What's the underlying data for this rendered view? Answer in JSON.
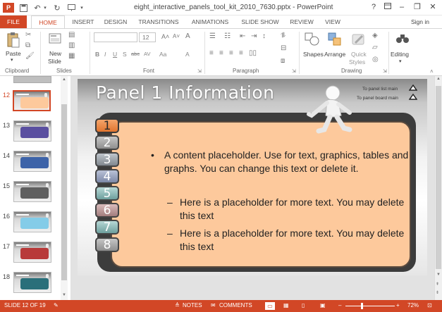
{
  "app": {
    "doc_title": "eight_interactive_panels_tool_kit_2010_7630.pptx - PowerPoint"
  },
  "tabs": [
    {
      "label": "FILE"
    },
    {
      "label": "HOME"
    },
    {
      "label": "INSERT"
    },
    {
      "label": "DESIGN"
    },
    {
      "label": "TRANSITIONS"
    },
    {
      "label": "ANIMATIONS"
    },
    {
      "label": "SLIDE SHOW"
    },
    {
      "label": "REVIEW"
    },
    {
      "label": "VIEW"
    }
  ],
  "signin": "Sign in",
  "ribbon": {
    "paste_label": "Paste",
    "new_slide_label": "New",
    "new_slide_label2": "Slide",
    "font_size": "12",
    "shapes_label": "Shapes",
    "arrange_label": "Arrange",
    "quick_styles_label": "Quick",
    "quick_styles_label2": "Styles",
    "editing_label": "Editing",
    "groups": {
      "clipboard": "Clipboard",
      "slides": "Slides",
      "font": "Font",
      "paragraph": "Paragraph",
      "drawing": "Drawing"
    },
    "format_buttons": [
      "B",
      "I",
      "U",
      "S",
      "abc",
      "AV",
      "Aa",
      "A"
    ]
  },
  "thumbnails": [
    {
      "num": "12",
      "color": "#fdc99c",
      "border": "#d24726",
      "active": true
    },
    {
      "num": "13",
      "color": "#5a4fa0",
      "border": "#bbbbbb",
      "active": false
    },
    {
      "num": "14",
      "color": "#3d63a8",
      "border": "#bbbbbb",
      "active": false
    },
    {
      "num": "15",
      "color": "#5f5f5f",
      "border": "#bbbbbb",
      "active": false
    },
    {
      "num": "16",
      "color": "#84cce8",
      "border": "#bbbbbb",
      "active": false
    },
    {
      "num": "17",
      "color": "#b83a3a",
      "border": "#bbbbbb",
      "active": false
    },
    {
      "num": "18",
      "color": "#2a6f7a",
      "border": "#bbbbbb",
      "active": false
    }
  ],
  "slide": {
    "title": "Panel 1 Information",
    "nav_list": "To panel list main",
    "nav_board": "To panel board main",
    "tabs": [
      "1",
      "2",
      "3",
      "4",
      "5",
      "6",
      "7",
      "8"
    ],
    "bullet1": "A content placeholder.  Use for text, graphics, tables and graphs.  You can change this text or delete it.",
    "bullet2": "Here is a placeholder for more text.  You may delete this text",
    "bullet3": "Here is a placeholder for more text.  You may delete this text"
  },
  "status": {
    "slide_counter": "SLIDE 12 OF 19",
    "notes": "NOTES",
    "comments": "COMMENTS",
    "zoom": "72%"
  },
  "colors": {
    "accent": "#d24726",
    "content_fill": "#fdc99c",
    "active_tab": "#e0742f"
  }
}
